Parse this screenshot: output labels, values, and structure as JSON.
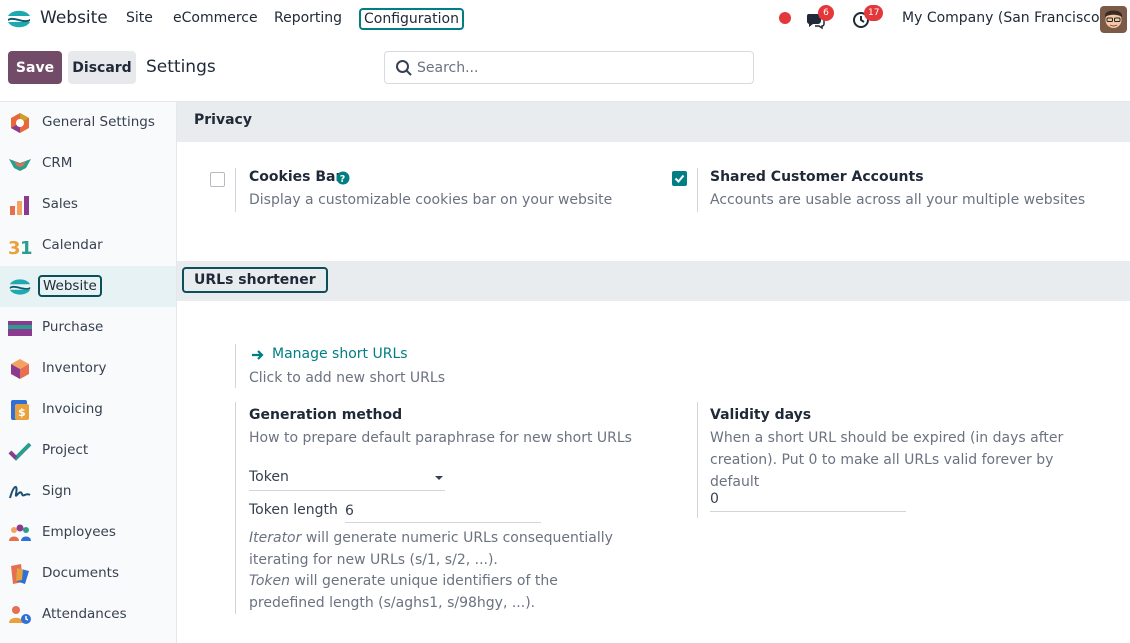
{
  "navbar": {
    "app_name": "Website",
    "menu": [
      "Site",
      "eCommerce",
      "Reporting",
      "Configuration"
    ],
    "messages_count": "6",
    "activities_count": "17",
    "company": "My Company (San Francisco)"
  },
  "control_panel": {
    "save_label": "Save",
    "discard_label": "Discard",
    "title": "Settings",
    "search_placeholder": "Search..."
  },
  "sidebar": {
    "items": [
      {
        "label": "General Settings",
        "icon": "general-settings-icon"
      },
      {
        "label": "CRM",
        "icon": "crm-icon"
      },
      {
        "label": "Sales",
        "icon": "sales-icon"
      },
      {
        "label": "Calendar",
        "icon": "calendar-icon"
      },
      {
        "label": "Website",
        "icon": "website-icon",
        "active": true
      },
      {
        "label": "Purchase",
        "icon": "purchase-icon"
      },
      {
        "label": "Inventory",
        "icon": "inventory-icon"
      },
      {
        "label": "Invoicing",
        "icon": "invoicing-icon"
      },
      {
        "label": "Project",
        "icon": "project-icon"
      },
      {
        "label": "Sign",
        "icon": "sign-icon"
      },
      {
        "label": "Employees",
        "icon": "employees-icon"
      },
      {
        "label": "Documents",
        "icon": "documents-icon"
      },
      {
        "label": "Attendances",
        "icon": "attendances-icon"
      }
    ]
  },
  "privacy": {
    "title": "Privacy",
    "cookies": {
      "title": "Cookies Bar",
      "desc": "Display a customizable cookies bar on your website",
      "checked": false
    },
    "shared": {
      "title": "Shared Customer Accounts",
      "desc": "Accounts are usable across all your multiple websites",
      "checked": true
    }
  },
  "urls": {
    "title": "URLs shortener",
    "manage_link": "Manage short URLs",
    "manage_desc": "Click to add new short URLs",
    "generation": {
      "title": "Generation method",
      "desc": "How to prepare default paraphrase for new short URLs",
      "selected": "Token",
      "token_length_label": "Token length",
      "token_length_value": "6",
      "help": {
        "iterator_term": "Iterator",
        "iterator_text": " will generate numeric URLs consequentially iterating for new URLs (s/1, s/2, ...).",
        "token_term": "Token",
        "token_text": " will generate unique identifiers of the predefined length (s/aghs1, s/98hgy, ...)."
      }
    },
    "validity": {
      "title": "Validity days",
      "desc": "When a short URL should be expired (in days after creation). Put 0 to make all URLs valid forever by default",
      "value": "0"
    }
  },
  "colors": {
    "primary": "#714b67",
    "teal": "#017e84",
    "badge": "#e4373b"
  }
}
